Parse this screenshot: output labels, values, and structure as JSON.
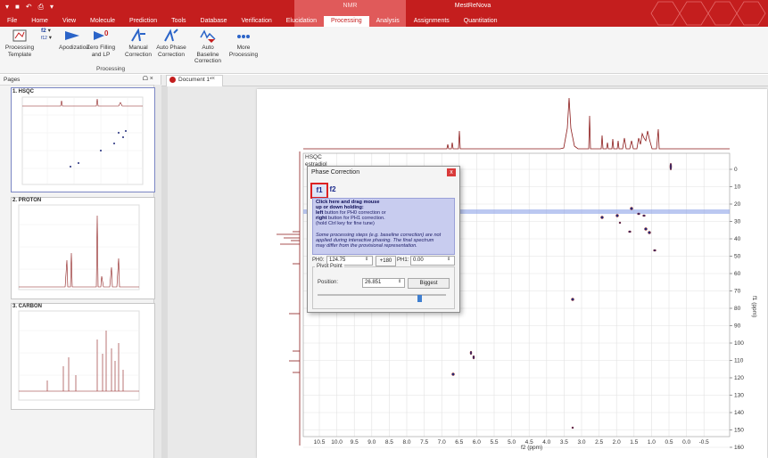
{
  "app": {
    "title": "MestReNova",
    "context_tab": "NMR"
  },
  "menu": [
    "File",
    "Home",
    "View",
    "Molecule",
    "Prediction",
    "Tools",
    "Database",
    "Verification",
    "Elucidation",
    "Processing",
    "Analysis",
    "Assignments",
    "Quantitation"
  ],
  "menu_active": "Processing",
  "ribbon": {
    "processing_template": "Processing Template",
    "f2": "f2",
    "f12": "f12",
    "apodization": "Apodization",
    "zero_filling": "Zero Filling and LP",
    "manual_correction": "Manual Correction",
    "auto_phase": "Auto Phase Correction",
    "auto_baseline": "Auto Baseline Correction",
    "more_processing": "More Processing",
    "group_label": "Processing"
  },
  "pages_panel": {
    "title": "Pages",
    "thumbs": [
      "1. HSQC",
      "2. PROTON",
      "3. CARBON"
    ]
  },
  "document_tab": "Document 1*",
  "spectrum": {
    "label_line1": "HSQC",
    "label_line2": "estradiol",
    "x_axis_title": "f2 (ppm)",
    "y_axis_title": "f1 (ppm)",
    "x_ticks": [
      "10.5",
      "10.0",
      "9.5",
      "9.0",
      "8.5",
      "8.0",
      "7.5",
      "7.0",
      "6.5",
      "6.0",
      "5.5",
      "5.0",
      "4.5",
      "4.0",
      "3.5",
      "3.0",
      "2.5",
      "2.0",
      "1.5",
      "1.0",
      "0.5",
      "0.0",
      "-0.5"
    ],
    "y_ticks": [
      "0",
      "10",
      "20",
      "30",
      "40",
      "50",
      "60",
      "70",
      "80",
      "90",
      "100",
      "110",
      "120",
      "130",
      "140",
      "150",
      "160"
    ],
    "line_color": "#8b1a1a",
    "cross_color": "#1f2a7a"
  },
  "phase_dialog": {
    "title": "Phase Correction",
    "close": "x",
    "tab_f1": "f1",
    "tab_f2": "f2",
    "info_line1": "Click here and drag mouse",
    "info_line2": "up or down holding:",
    "info_left_bold": "left",
    "info_left_rest": " button for PH0 correction or",
    "info_right_bold": "right",
    "info_right_rest": " button for PH1 correction.",
    "info_ctrl": "(hold Ctrl key for fine tune)",
    "note_1": "Some processing steps (e.g. baseline correction) are not",
    "note_2": "applied during interactive phasing. The final spectrum",
    "note_3": "may differ from the provisional representation.",
    "ph0_label": "PH0:",
    "ph0_value": "124.75",
    "btn_180": "+180",
    "ph1_label": "PH1:",
    "ph1_value": "0.00",
    "pivot_title": "Pivot Point",
    "position_label": "Position:",
    "position_value": "26.851",
    "biggest": "Biggest"
  }
}
